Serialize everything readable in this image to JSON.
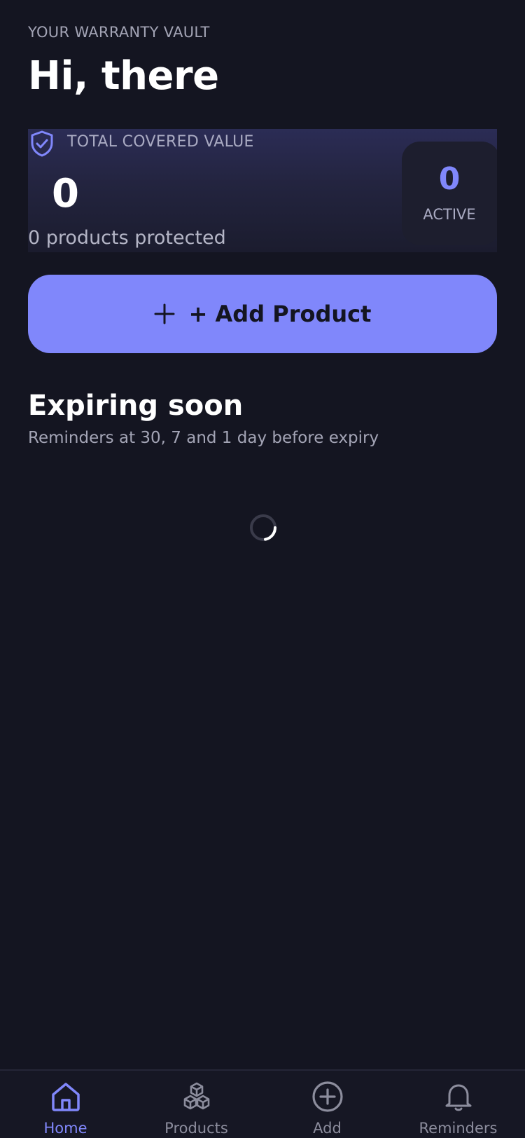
{
  "header": {
    "eyebrow": "YOUR WARRANTY VAULT",
    "greeting": "Hi, there"
  },
  "summary_card": {
    "icon": "shield-check-icon",
    "label": "TOTAL COVERED VALUE",
    "value": "0",
    "subtitle": "0 products protected",
    "active_count": "0",
    "active_label": "ACTIVE"
  },
  "add_button": {
    "icon": "plus-icon",
    "label": "+ Add Product"
  },
  "expiring": {
    "title": "Expiring soon",
    "subtitle": "Reminders at 30, 7 and 1 day before expiry"
  },
  "tabbar": {
    "tabs": [
      {
        "label": "Home",
        "icon": "home-icon",
        "active": true
      },
      {
        "label": "Products",
        "icon": "cubes-icon",
        "active": false
      },
      {
        "label": "Add",
        "icon": "plus-circle-icon",
        "active": false
      },
      {
        "label": "Reminders",
        "icon": "bell-icon",
        "active": false
      }
    ]
  },
  "colors": {
    "background": "#141521",
    "accent": "#8087fb",
    "muted_text": "#a3a4b5"
  }
}
